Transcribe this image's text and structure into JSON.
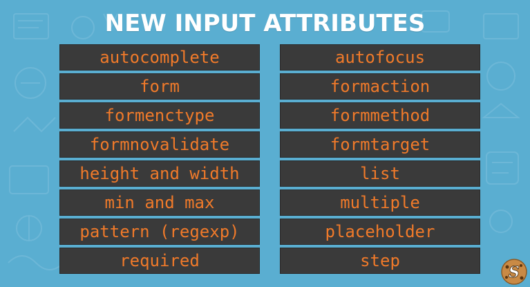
{
  "title": "NEW INPUT ATTRIBUTES",
  "left_column": [
    "autocomplete",
    "form",
    "formenctype",
    "formnovalidate",
    "height and width",
    "min and max",
    "pattern (regexp)",
    "required"
  ],
  "right_column": [
    "autofocus",
    "formaction",
    "formmethod",
    "formtarget",
    "list",
    "multiple",
    "placeholder",
    "step"
  ],
  "colors": {
    "background": "#5aaed1",
    "box": "#3a3a3a",
    "box_text": "#f07a2a",
    "title": "#ffffff"
  },
  "logo": {
    "letter": "S",
    "icon": "cookie-logo-icon"
  }
}
